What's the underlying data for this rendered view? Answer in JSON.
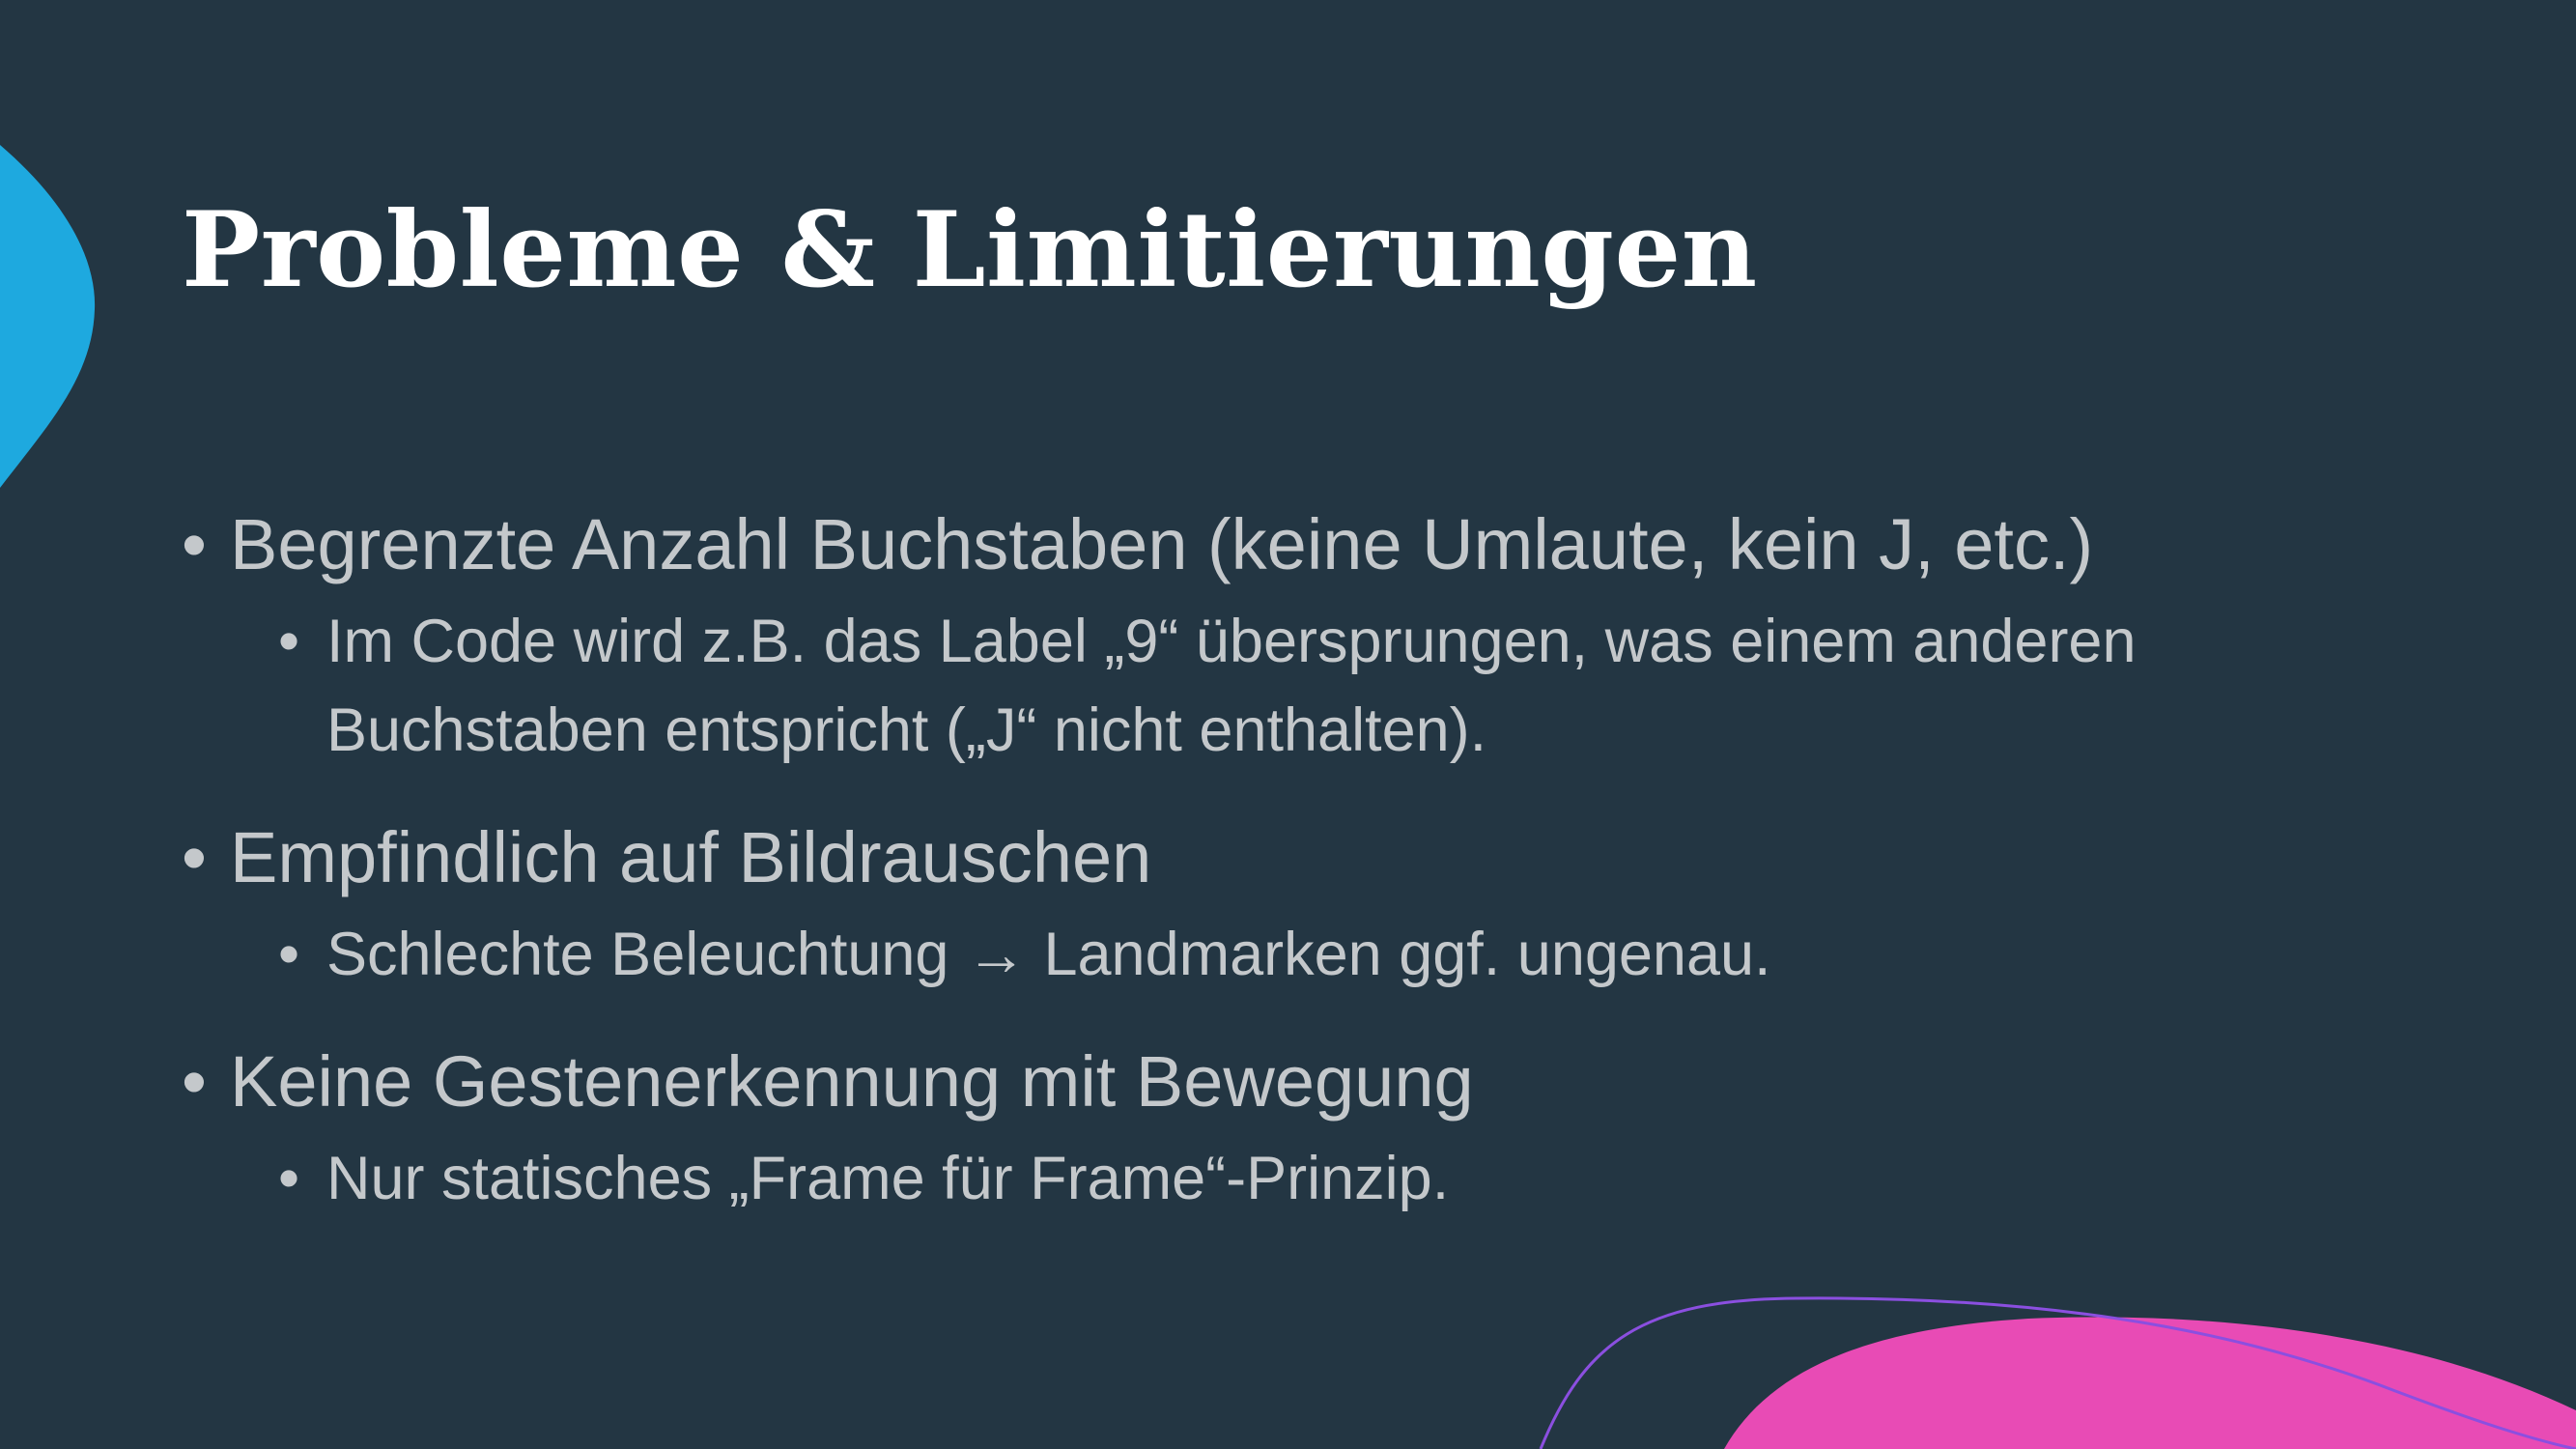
{
  "slide": {
    "title": "Probleme & Limitierungen",
    "bullet_symbol": "•",
    "items": [
      {
        "text": "Begrenzte Anzahl Buchstaben (keine Umlaute, kein J, etc.)",
        "subitems": [
          "Im Code wird z.B. das Label „9“ übersprungen, was einem anderen Buchstaben entspricht („J“ nicht enthalten)."
        ]
      },
      {
        "text": "Empfindlich auf Bildrauschen",
        "subitems": [
          "Schlechte Beleuchtung → Landmarken ggf. ungenau."
        ]
      },
      {
        "text": "Keine Gestenerkennung mit Bewegung",
        "subitems": [
          "Nur statisches „Frame für Frame“-Prinzip."
        ]
      }
    ]
  },
  "colors": {
    "background": "#233643",
    "title": "#ffffff",
    "body_text": "#c4c8cb",
    "accent_blue": "#1ea9df",
    "accent_pink": "#e84bb5",
    "accent_purple_line": "#8b4fe0"
  }
}
